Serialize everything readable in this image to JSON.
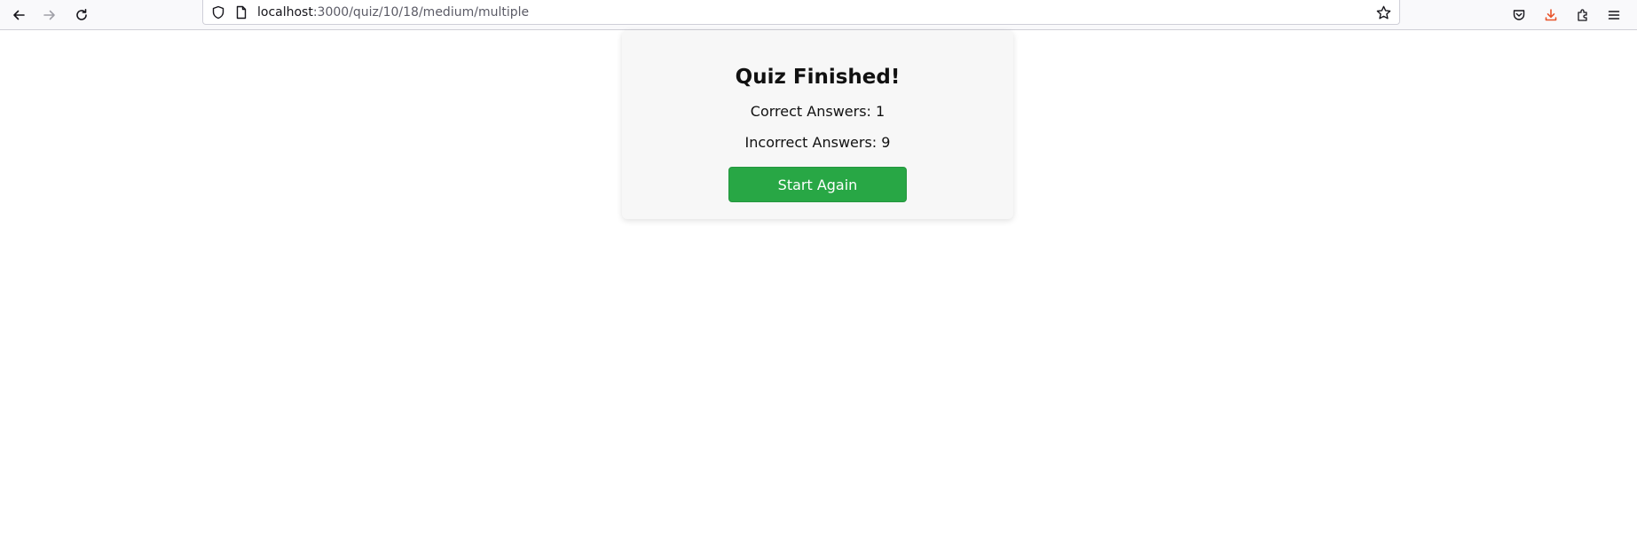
{
  "browser": {
    "url": {
      "host": "localhost",
      "path": ":3000/quiz/10/18/medium/multiple"
    },
    "icons": {
      "back": "arrow-left-icon",
      "forward": "arrow-right-icon",
      "reload": "reload-icon",
      "tracking_protection": "shield-icon",
      "page_info": "page-icon",
      "bookmark": "star-icon",
      "pocket": "pocket-icon",
      "downloads": "download-icon",
      "extensions": "puzzle-icon",
      "menu": "hamburger-menu-icon"
    },
    "colors": {
      "toolbar_bg": "#f9f9fb",
      "download_accent": "#e8542b"
    }
  },
  "quiz_result": {
    "title": "Quiz Finished!",
    "correct_label": "Correct Answers: 1",
    "incorrect_label": "Incorrect Answers: 9",
    "restart_button": "Start Again",
    "colors": {
      "button_bg": "#28a745",
      "card_bg": "#f7f7f7"
    }
  }
}
